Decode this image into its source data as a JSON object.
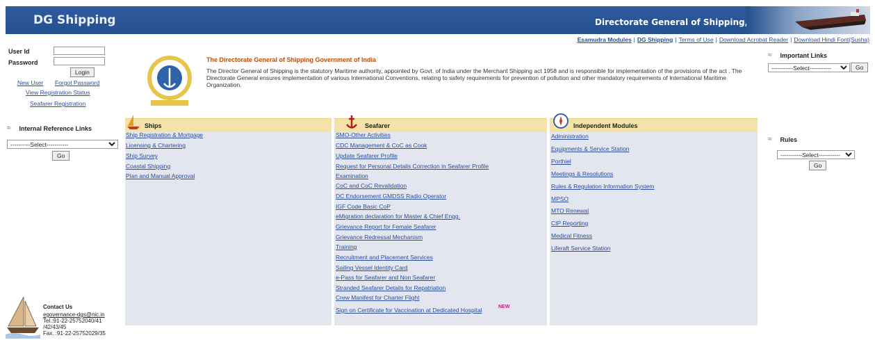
{
  "header": {
    "brand": "DG Shipping",
    "department": "Directorate General of Shipping, Mumbai"
  },
  "topnav": {
    "items": [
      "Esamudra Modules",
      "DG Shipping",
      "Terms of Use",
      "Download Acrobat Reader",
      "Download Hindi Font(Susha)"
    ]
  },
  "login": {
    "userid_label": "User Id",
    "password_label": "Password",
    "login_button": "Login",
    "new_user": "New User",
    "forgot_password": "Forgot Password",
    "view_registration_status": "View Registration Status",
    "seafarer_registration": "Seafarer Registration"
  },
  "internal_links": {
    "title": "Internal Reference Links",
    "select_value": "----------Select-----------",
    "go_button": "Go"
  },
  "important_links": {
    "title": "Important Links",
    "select_value": "-----------Select-----------",
    "go_button": "Go"
  },
  "rules": {
    "title": "Rules",
    "select_value": "-----------Select-----------",
    "go_button": "Go"
  },
  "intro": {
    "title": "The Directorate General of Shipping Government of India",
    "text": "The Director General of Shipping is the statutory Maritime authority, appointed by Govt. of India under the Merchant Shipping act 1958 and is responsible for implementation of the provisions of the act . The Directorate General ensures implementation of various International Conventions, relating to safety requirements for prevention of pollution and other mandatory requirements of International Maritime Organization."
  },
  "ships": {
    "title": "Ships",
    "links": [
      "Ship Registration & Mortgage",
      "Licensing & Chartering",
      "Ship Survey",
      "Coastal Shipping",
      "Plan and Manual Approval"
    ]
  },
  "seafarer": {
    "title": "Seafarer",
    "links": [
      "SMO-Other Activities",
      "CDC Management & CoC as Cook",
      "Update Seafarer Profile",
      "Request for Personal Details Correction in Seafarer Profile",
      "Examination",
      "CoC and CoC Revalidation",
      "DC Endorsement GMDSS Radio Operator",
      "IGF Code Basic CoP",
      "eMigration declaration for Master & Chief Engg.",
      "Grievance Report for Female Seafarer",
      "Grievance Redressal Mechanism",
      "Training",
      "Recruitment and Placement Services",
      "Sailing Vessel Identity Card",
      "e-Pass for Seafarer and Non Seafarer",
      "Stranded Seafarer Details for Repatriation",
      "Crew Manifest for Charter Flight",
      "Sign on Certificate for Vaccination at Dedicated Hospital"
    ],
    "new_badge": "NEW"
  },
  "independent": {
    "title": "Independent Modules",
    "links": [
      "Administration",
      "Equipments & Service Station",
      "Porthiel",
      "Meetings & Resolutions",
      "Rules & Regulation Information System",
      "MPSO",
      "MTO Renewal",
      "CIP Reporting",
      "Medical Fitness",
      "Liferaft Service Station"
    ]
  },
  "contact": {
    "title": "Contact Us",
    "email": "egovernance-dgs@nic.in",
    "tel1": "Tel.:91-22-25752040/41",
    "tel2": "/42/43/45",
    "fax": "Fax. :91-22-25752029/35"
  },
  "colors": {
    "header_blue": "#24508f",
    "link_blue": "#2a4d9b",
    "intro_title_orange": "#c24b00",
    "column_bg": "#e3e6ee",
    "column_head_bg": "#f3e3a8"
  }
}
